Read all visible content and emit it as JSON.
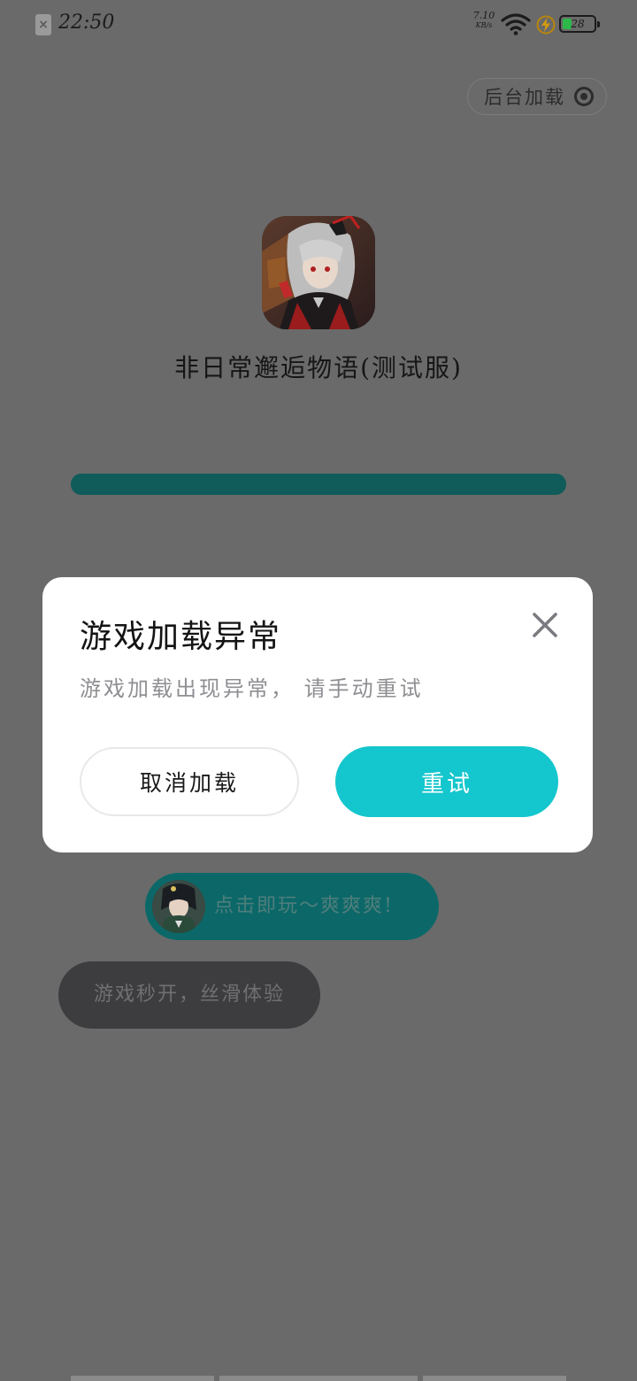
{
  "status_bar": {
    "time": "22:50",
    "net_speed_value": "7.10",
    "net_speed_unit": "KB/s",
    "battery_level": "28",
    "battery_percent": 28
  },
  "loader": {
    "background_button_label": "后台加载",
    "app_title": "非日常邂逅物语(测试服)",
    "progress": 1.0
  },
  "dialog": {
    "title": "游戏加载异常",
    "message": "游戏加载出现异常， 请手动重试",
    "cancel_label": "取消加载",
    "retry_label": "重试"
  },
  "promo": {
    "play_label": "点击即玩～爽爽爽!",
    "feature_label": "游戏秒开，丝滑体验"
  },
  "colors": {
    "accent": "#14c6cd",
    "overlay": "#6a6a6a",
    "progress": "#0d5654"
  }
}
